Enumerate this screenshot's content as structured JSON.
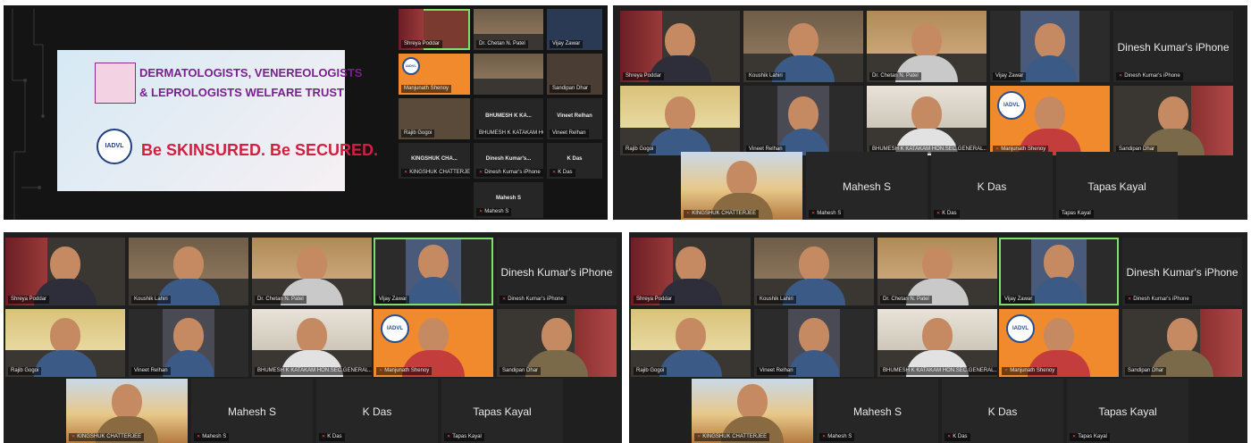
{
  "slide": {
    "line1": "DERMATOLOGISTS, VENEREOLOGISTS",
    "line2": "& LEPROLOGISTS WELFARE TRUST",
    "tagline": "Be SKINSURED. Be SECURED.",
    "logo_text": "IADVL"
  },
  "panel1_thumbs": {
    "t1": "Shreya Poddar",
    "t2": "Dr. Chetan N. Patel",
    "t3": "Vijay Zawar",
    "t4": "Manjunath Shenoy",
    "t5": "Koushik Lahiri",
    "t6": "Rajib Gogoi",
    "t7": "Sandipan Dhar",
    "t8_center": "BHUMESH K KA...",
    "t8_label": "BHUMESH K KATAKAM HON.SEC.GENERAL",
    "t9_center": "Vineet Relhan",
    "t9_label": "Vineet Relhan",
    "t10_center": "KINGSHUK CHA...",
    "t10_label": "KINGSHUK CHATTERJEE",
    "t11_center": "Dinesh Kumar's...",
    "t11_label": "Dinesh Kumar's iPhone",
    "t12_center": "K Das",
    "t12_label": "K Das",
    "t13_center": "Mahesh S",
    "t13_label": "Mahesh S",
    "t14_label": "Koushik Lahiri"
  },
  "gallery": {
    "shreya": "Shreya Poddar",
    "koushik": "Koushik Lahiri",
    "chetan": "Dr. Chetan N. Patel",
    "vijay": "Vijay Zawar",
    "dinesh_center": "Dinesh Kumar's iPhone",
    "dinesh_label": "Dinesh Kumar's iPhone",
    "rajib": "Rajib Gogoi",
    "vineet": "Vineet Relhan",
    "bhumesh": "BHUMESH K KATAKAM HON.SEC.GENERAL...",
    "manjunath": "Manjunath Shenoy",
    "sandipan": "Sandipan Dhar",
    "kingshuk": "KINGSHUK CHATTERJEE",
    "mahesh": "Mahesh S",
    "kdas": "K Das",
    "tapas": "Tapas Kayal",
    "iadvl_logo": "IADVL"
  },
  "colors": {
    "meeting_bg": "#1f1f1f",
    "tile_bg": "#262626",
    "speaker_border": "#7ee06a",
    "muted_icon": "#ff4d4d",
    "slide_title": "#7a1f8f",
    "slide_tagline": "#d01f3f"
  }
}
